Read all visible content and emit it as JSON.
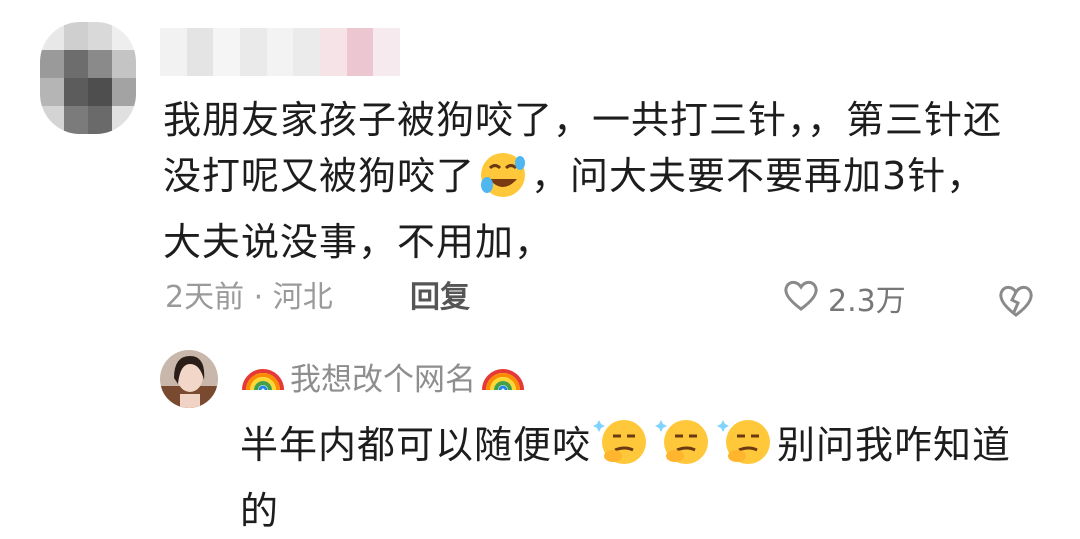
{
  "comment": {
    "text_part1": "我朋友家孩子被狗咬了，一共打三针，，第三针还没打呢又被狗咬了",
    "emoji_1": "rofl-emoji",
    "text_part2": "，问大夫要不要再加3针，大夫说没事，不用加，",
    "meta": "2天前 · 河北",
    "reply_label": "回复",
    "like_count": "2.3万",
    "icons": {
      "like": "heart-outline-icon",
      "dislike": "broken-heart-icon"
    }
  },
  "reply": {
    "username": "我想改个网名",
    "name_decoration": "rainbow-emoji",
    "text_part1": "半年内都可以随便咬",
    "emoji": "smirking-thinking-emoji",
    "text_part2": "别问我咋知道的"
  },
  "colors": {
    "text": "#1d1d1d",
    "meta": "#9a9a9a",
    "background": "#ffffff"
  }
}
